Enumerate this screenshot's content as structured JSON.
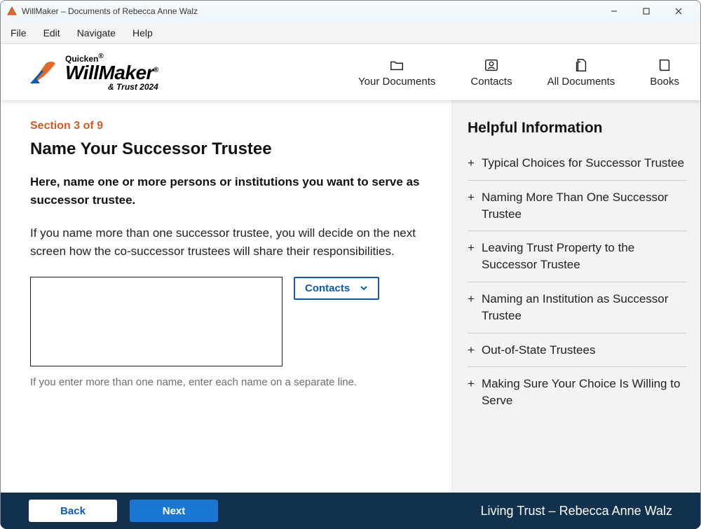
{
  "window": {
    "title": "WillMaker – Documents of Rebecca Anne Walz"
  },
  "menubar": [
    "File",
    "Edit",
    "Navigate",
    "Help"
  ],
  "logo": {
    "brand_small": "Quicken",
    "brand_main": "WillMaker",
    "brand_reg": "®",
    "brand_sub": "& Trust 2024"
  },
  "toolbar": {
    "items": [
      {
        "label": "Your Documents"
      },
      {
        "label": "Contacts"
      },
      {
        "label": "All Documents"
      },
      {
        "label": "Books"
      }
    ]
  },
  "content": {
    "section_label": "Section 3 of 9",
    "title": "Name Your Successor Trustee",
    "lead": "Here, name one or more persons or institutions you want to serve as successor trustee.",
    "paragraph": "If you name more than one successor trustee, you will decide on the next screen how the co-successor trustees will share their responsibilities.",
    "textarea_value": "",
    "contacts_button": "Contacts",
    "hint": "If you enter more than one name, enter each name on a separate line."
  },
  "helppanel": {
    "title": "Helpful Information",
    "items": [
      "Typical Choices for Successor Trustee",
      "Naming More Than One Successor Trustee",
      "Leaving Trust Property to the Successor Trustee",
      "Naming an Institution as Successor Trustee",
      "Out-of-State Trustees",
      "Making Sure Your Choice Is Willing to Serve"
    ]
  },
  "footer": {
    "back": "Back",
    "next": "Next",
    "status": "Living Trust – Rebecca Anne Walz"
  }
}
